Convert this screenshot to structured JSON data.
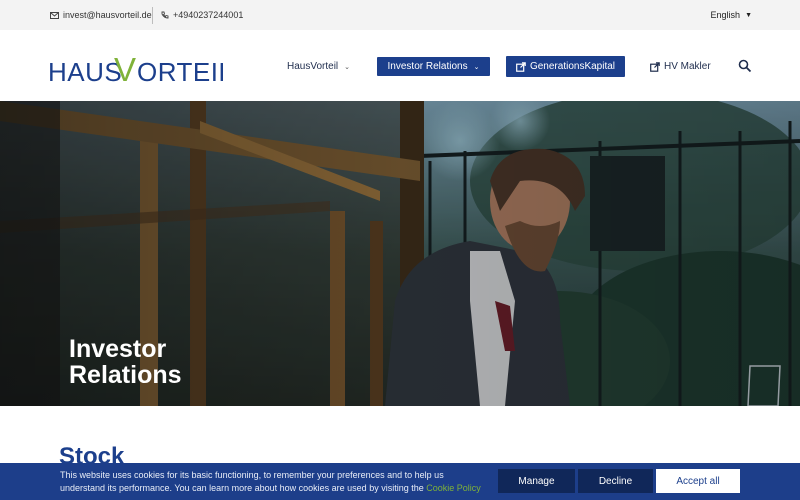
{
  "topbar": {
    "email": "invest@hausvorteil.de",
    "phone": "+4940237244001",
    "language": "English"
  },
  "brand": {
    "logo_part1": "HAUS",
    "logo_part2": "V",
    "logo_part3": "ORTEIL",
    "primary_color": "#1c3f8c",
    "accent_color": "#7fb239"
  },
  "nav": {
    "hausvorteil": "HausVorteil",
    "investor_relations": "Investor Relations",
    "generationskapital": "GenerationsKapital",
    "hv_makler": "HV Makler"
  },
  "hero": {
    "title": "Investor Relations"
  },
  "section": {
    "heading": "Stock"
  },
  "cookie": {
    "text": "This website uses cookies for its basic functioning, to remember your preferences and to help us understand its performance. You can learn more about how cookies are used by visiting the",
    "link": "Cookie Policy",
    "manage": "Manage",
    "decline": "Decline",
    "accept": "Accept all"
  }
}
